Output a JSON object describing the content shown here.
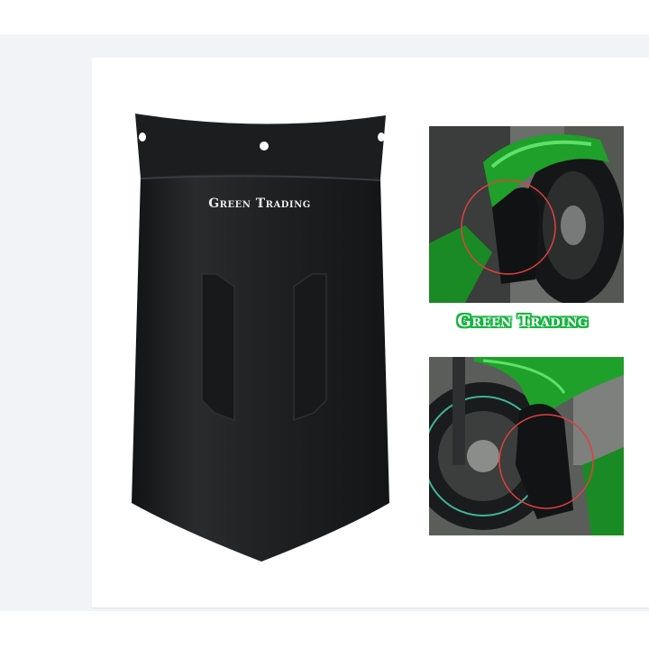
{
  "listing": {
    "brand_on_product": "Green Trading",
    "brand_caption": "Green Trading",
    "colors": {
      "product": "#1e1f20",
      "bike_green": "#1fa02a",
      "caption_glow": "#12b43c",
      "highlight_circle": "#e04040"
    },
    "photos": [
      {
        "name": "installed-front-view"
      },
      {
        "name": "installed-side-view"
      }
    ]
  }
}
